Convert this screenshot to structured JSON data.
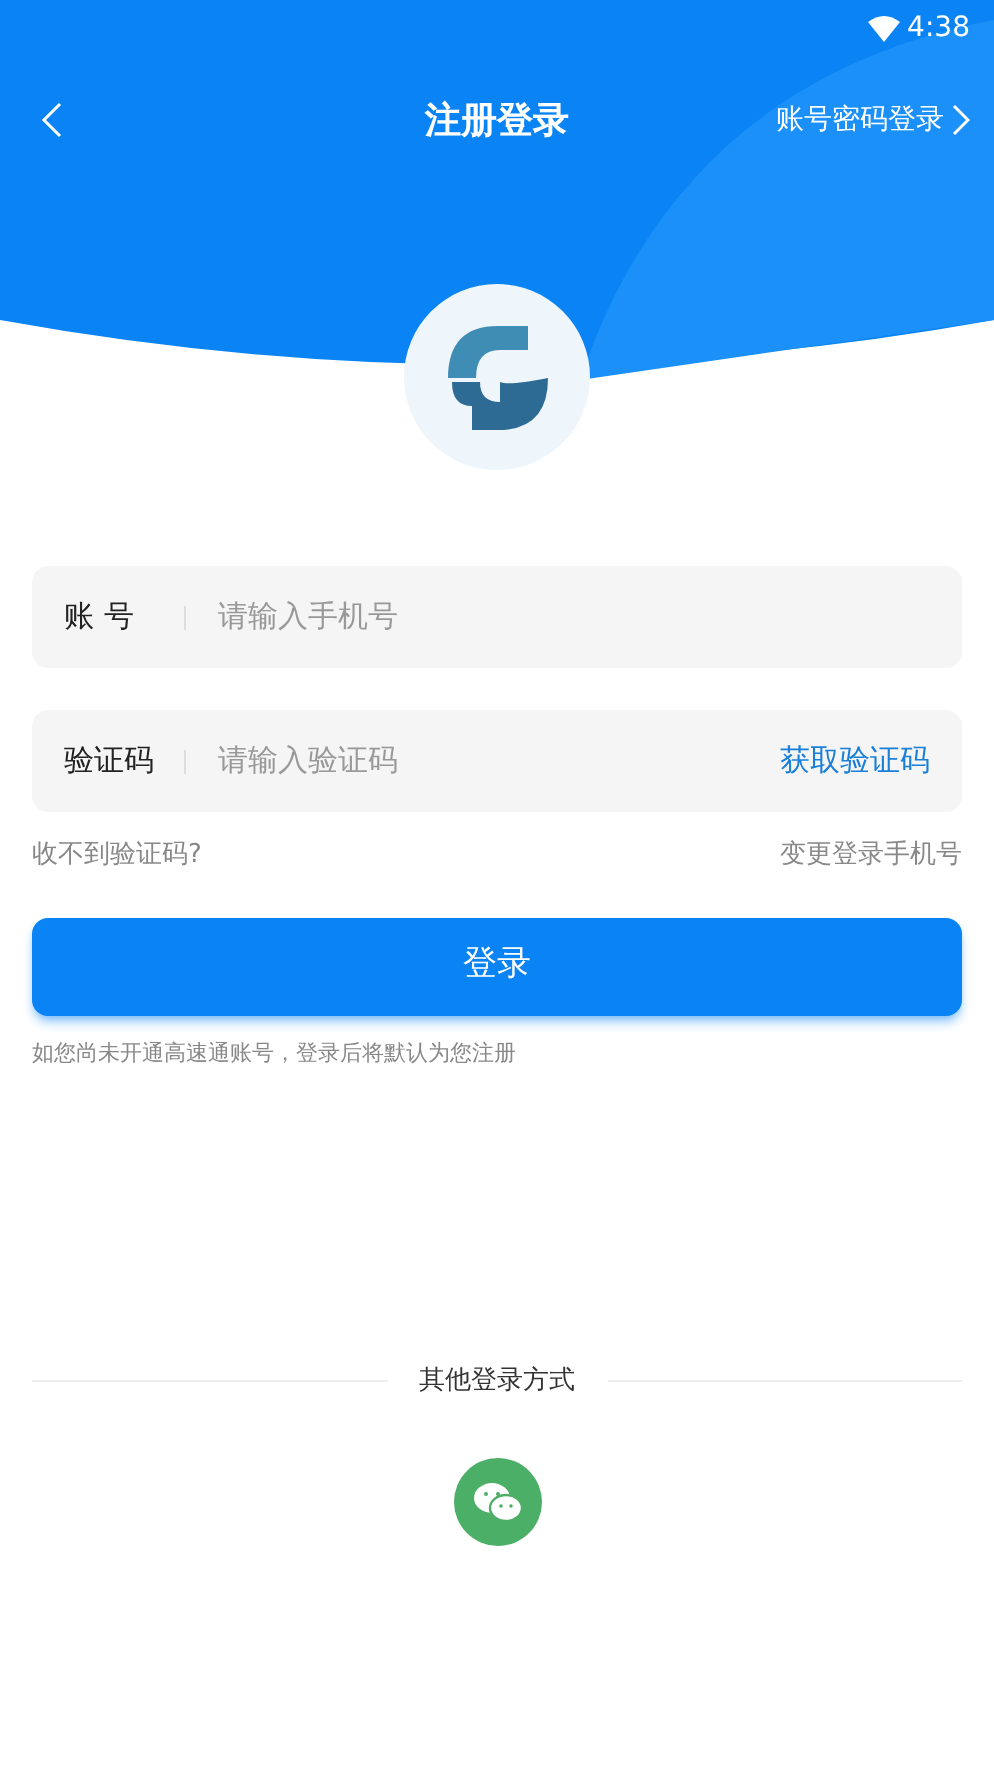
{
  "status_bar": {
    "time": "4:38"
  },
  "nav": {
    "title": "注册登录",
    "right_link": "账号密码登录"
  },
  "fields": [
    {
      "label": "账 号",
      "placeholder": "请输入手机号"
    },
    {
      "label": "验证码",
      "placeholder": "请输入验证码",
      "action": "获取验证码"
    }
  ],
  "links": [
    "收不到验证码?",
    "变更登录手机号"
  ],
  "login_button": "登录",
  "notice": "如您尚未开通高速通账号，登录后将默认为您注册",
  "other_login": {
    "title": "其他登录方式"
  }
}
